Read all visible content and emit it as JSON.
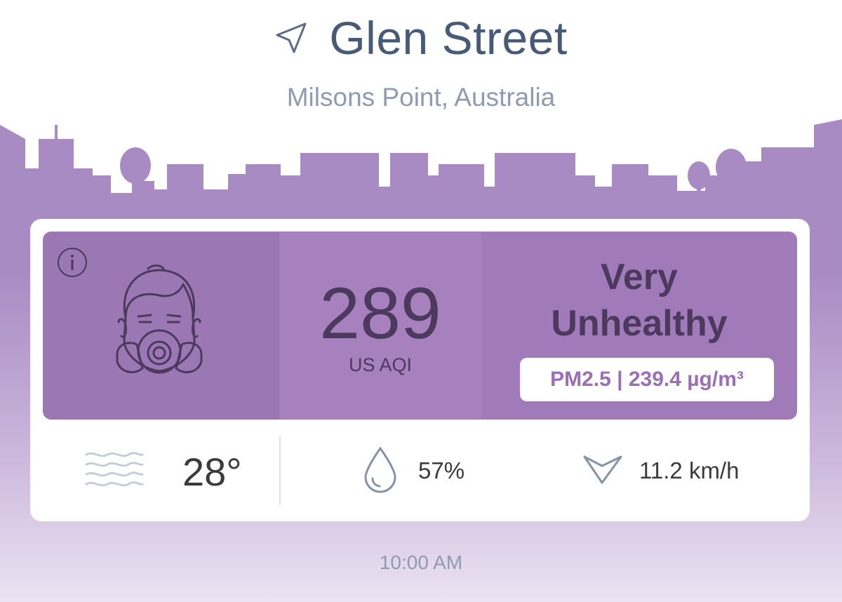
{
  "location": {
    "title": "Glen Street",
    "subtitle": "Milsons Point, Australia",
    "icon": "navigation-arrow-icon"
  },
  "aqi": {
    "value": "289",
    "unit": "US AQI",
    "status_line1": "Very",
    "status_line2": "Unhealthy",
    "pollutant": "PM2.5 | 239.4 µg/m³",
    "colors": {
      "banner": "#a07ab9",
      "face_panel": "#9b78b3",
      "text": "#4b3a5e",
      "chip_text": "#9b6fb8"
    }
  },
  "weather": {
    "temperature": "28°",
    "humidity": "57%",
    "wind": "11.2 km/h",
    "icons": [
      "haze-icon",
      "humidity-drop-icon",
      "wind-direction-icon"
    ]
  },
  "timestamp": "10:00 AM",
  "theme": {
    "skyline": "#a98bc4",
    "gradient_bottom": "#ece3f2"
  }
}
